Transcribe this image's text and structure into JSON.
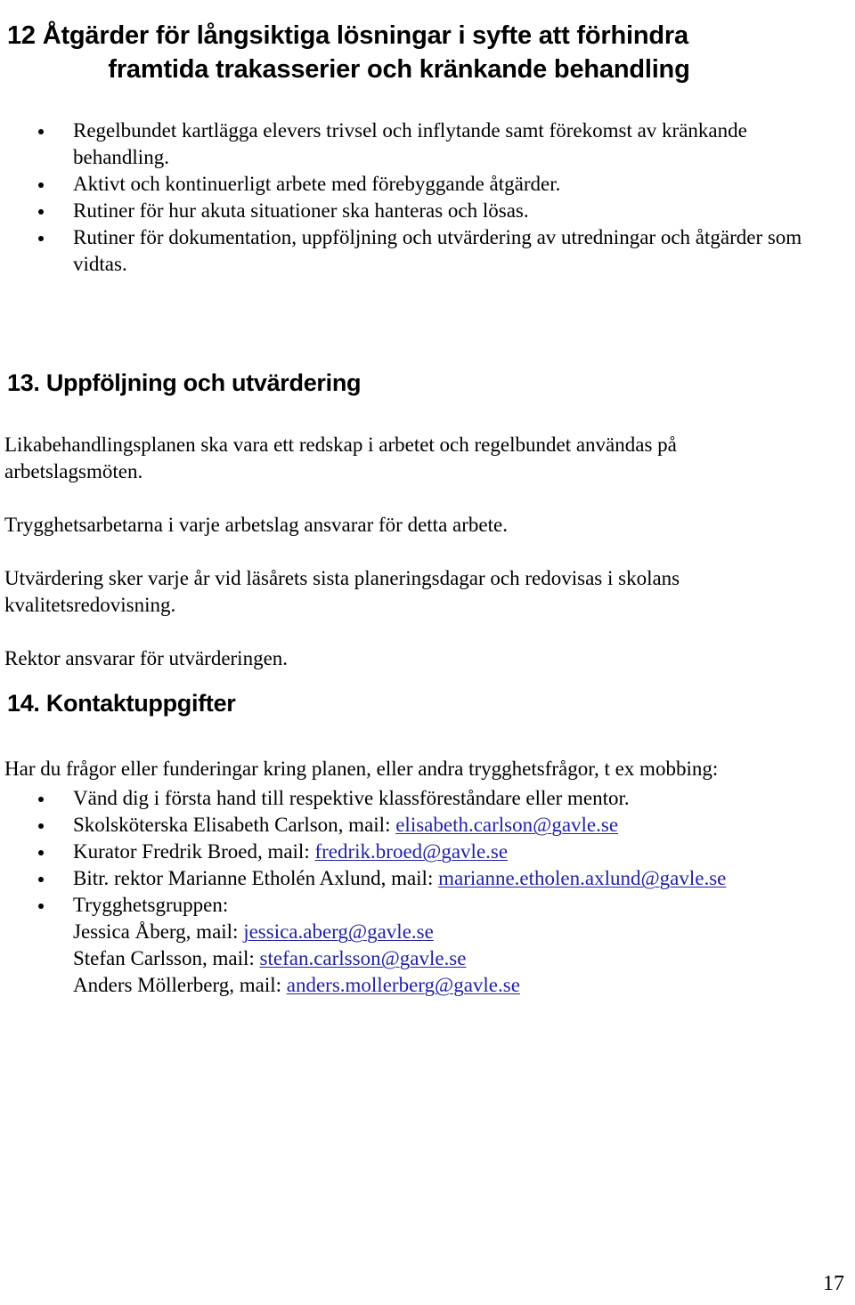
{
  "document": {
    "page_number": "17",
    "link_color": "#2222A5",
    "text_color": "#000000",
    "background_color": "#ffffff"
  },
  "heading_main": {
    "line1": "12 Åtgärder för långsiktiga lösningar i syfte att förhindra",
    "line2": "framtida trakasserier och kränkande behandling"
  },
  "list_top": {
    "items": [
      "Regelbundet kartlägga elevers trivsel och inflytande samt förekomst av kränkande behandling.",
      "Aktivt och kontinuerligt arbete med förebyggande åtgärder.",
      "Rutiner för hur akuta situationer ska hanteras och lösas.",
      "Rutiner för dokumentation, uppföljning och utvärdering av utredningar och åtgärder som vidtas."
    ]
  },
  "section13": {
    "heading": "13. Uppföljning och utvärdering",
    "paragraphs": [
      "Likabehandlingsplanen ska vara ett redskap i arbetet och regelbundet användas på arbetslagsmöten.",
      "Trygghetsarbetarna i varje arbetslag ansvarar för detta arbete.",
      "Utvärdering sker varje år vid läsårets sista planeringsdagar och redovisas i skolans kvalitetsredovisning.",
      "Rektor ansvarar för utvärderingen."
    ]
  },
  "section14": {
    "heading": "14. Kontaktuppgifter",
    "intro": "Har du frågor eller funderingar kring planen, eller andra trygghetsfrågor, t ex mobbing:",
    "contacts": [
      {
        "text": "Vänd dig i första hand till respektive klassföreståndare eller mentor.",
        "email": ""
      },
      {
        "text": "Skolsköterska Elisabeth Carlson, mail: ",
        "email": "elisabeth.carlson@gavle.se"
      },
      {
        "text": "Kurator Fredrik Broed, mail: ",
        "email": "fredrik.broed@gavle.se"
      },
      {
        "text": "Bitr. rektor Marianne Etholén Axlund, mail: ",
        "email": "marianne.etholen.axlund@gavle.se"
      }
    ],
    "group": {
      "label": "Trygghetsgruppen:",
      "members": [
        {
          "text": "Jessica Åberg, mail: ",
          "email": "jessica.aberg@gavle.se"
        },
        {
          "text": "Stefan Carlsson, mail: ",
          "email": "stefan.carlsson@gavle.se"
        },
        {
          "text": "Anders Möllerberg, mail: ",
          "email": "anders.mollerberg@gavle.se"
        }
      ]
    }
  }
}
